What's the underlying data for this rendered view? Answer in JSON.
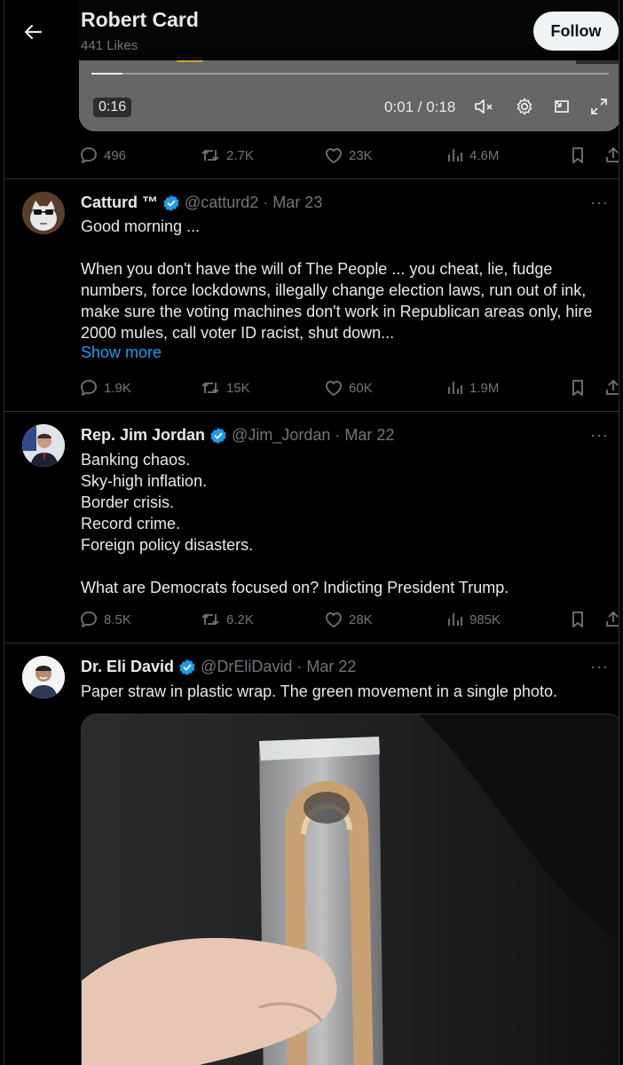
{
  "header": {
    "title": "Robert Card",
    "subtitle": "441 Likes",
    "follow_label": "Follow"
  },
  "video": {
    "duration_chip": "0:16",
    "time_readout": "0:01 / 0:18",
    "progress_fraction": 0.06
  },
  "video_tweet_stats": {
    "replies": "496",
    "reposts": "2.7K",
    "likes": "23K",
    "views": "4.6M"
  },
  "tweets": [
    {
      "name": "Catturd ™",
      "handle": "@catturd2",
      "date": "· Mar 23",
      "verified": true,
      "lines": [
        "Good morning ...",
        "",
        "When you don't have the will of The People ... you cheat, lie, fudge",
        "numbers, force lockdowns, illegally change election laws, run out of ink,",
        "make sure the voting machines don't work in Republican areas only, hire",
        "2000 mules, call voter ID racist, shut down..."
      ],
      "show_more": "Show more",
      "stats": {
        "replies": "1.9K",
        "reposts": "15K",
        "likes": "60K",
        "views": "1.9M"
      }
    },
    {
      "name": "Rep. Jim Jordan",
      "handle": "@Jim_Jordan",
      "date": "· Mar 22",
      "verified": true,
      "lines": [
        "Banking chaos.",
        "Sky-high inflation.",
        "Border crisis.",
        "Record crime.",
        "Foreign policy disasters.",
        "",
        "What are Democrats focused on? Indicting President Trump."
      ],
      "stats": {
        "replies": "8.5K",
        "reposts": "6.2K",
        "likes": "28K",
        "views": "985K"
      }
    },
    {
      "name": "Dr. Eli David",
      "handle": "@DrEliDavid",
      "date": "· Mar 22",
      "verified": true,
      "lines": [
        "Paper straw in plastic wrap. The green movement in a single photo."
      ]
    }
  ],
  "colors": {
    "background": "#000000",
    "text": "#e7e9ea",
    "muted": "#71767b",
    "link": "#1d9bf0",
    "verified": "#1d9bf0",
    "divider": "#2f3336"
  }
}
